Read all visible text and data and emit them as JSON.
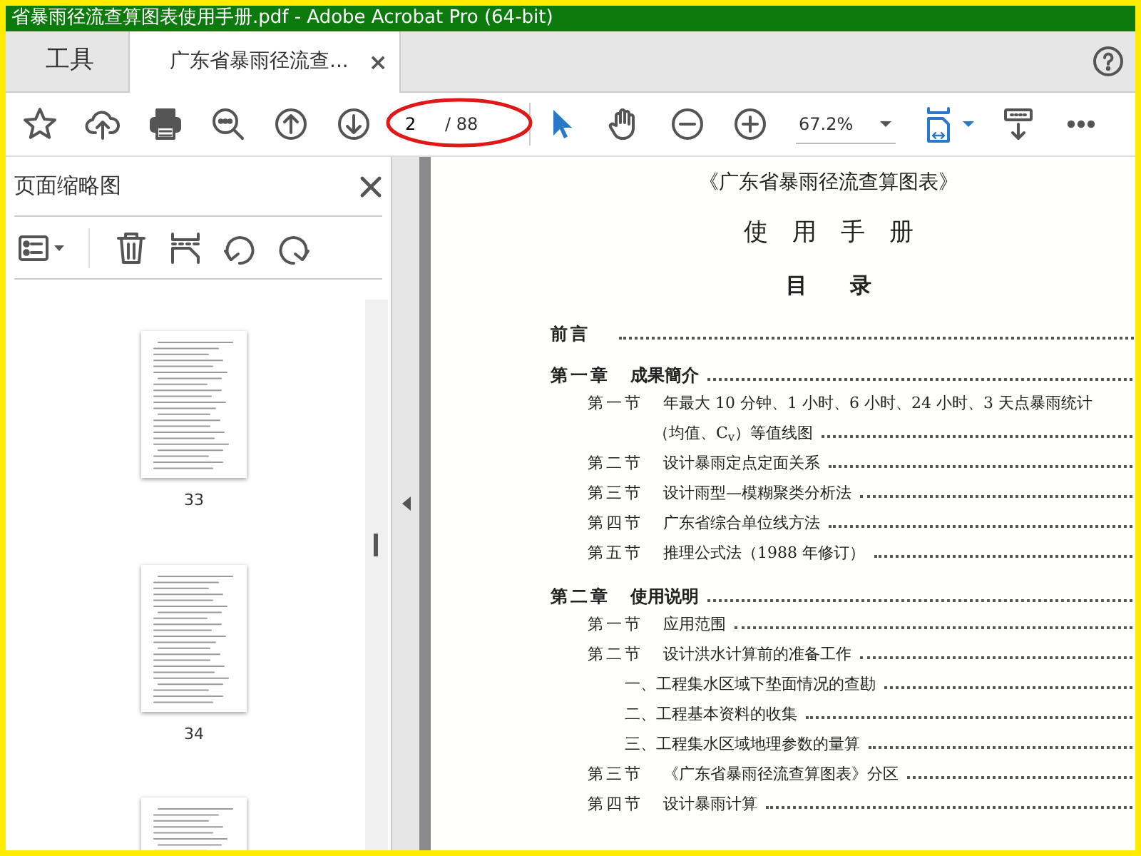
{
  "window": {
    "title": "省暴雨径流查算图表使用手册.pdf - Adobe Acrobat Pro (64-bit)"
  },
  "tabs": [
    {
      "label": "工具",
      "selected": false
    },
    {
      "label": "广东省暴雨径流查...",
      "selected": true,
      "close": "×"
    }
  ],
  "toolbar": {
    "page_nav": {
      "value": "2",
      "total": "/ 88",
      "circled": true
    },
    "pointer_tool": {
      "selected": true
    },
    "hand_tool": {
      "selected": false
    },
    "zoom": "67.2%"
  },
  "sidebar": {
    "title": "页面缩略图",
    "thumbnails": [
      {
        "label": "33",
        "kind": "full"
      },
      {
        "label": "34",
        "kind": "full"
      },
      {
        "kind": "partial"
      }
    ]
  },
  "document": {
    "title": "《广东省暴雨径流查算图表》",
    "subtitle": "使　用　手　册",
    "contents_heading": "目　　录",
    "toc": [
      {
        "label": "前言"
      },
      {
        "label": "第一章",
        "text": "成果簡介",
        "children": [
          {
            "label": "第一节",
            "text": "年最大 10 分钟、1 小时、6 小时、24 小时、3 天点暴雨统计",
            "continuation": "（均值、C$_{v}$）等值线图"
          },
          {
            "label": "第二节",
            "text": "设计暴雨定点定面关系"
          },
          {
            "label": "第三节",
            "text": "设计雨型—模糊聚类分析法"
          },
          {
            "label": "第四节",
            "text": "广东省综合单位线方法"
          },
          {
            "label": "第五节",
            "text": "推理公式法（1988 年修订）"
          }
        ]
      },
      {
        "label": "第二章",
        "text": "使用说明",
        "children": [
          {
            "label": "第一节",
            "text": "应用范围"
          },
          {
            "label": "第二节",
            "text": "设计洪水计算前的准备工作",
            "children": [
              {
                "text": "一、工程集水区域下垫面情况的查勘"
              },
              {
                "text": "二、工程基本资料的收集"
              },
              {
                "text": "三、工程集水区域地理参数的量算"
              }
            ]
          },
          {
            "label": "第三节",
            "text": "《广东省暴雨径流查算图表》分区"
          },
          {
            "label": "第四节",
            "text": "设计暴雨计算"
          }
        ]
      }
    ]
  }
}
